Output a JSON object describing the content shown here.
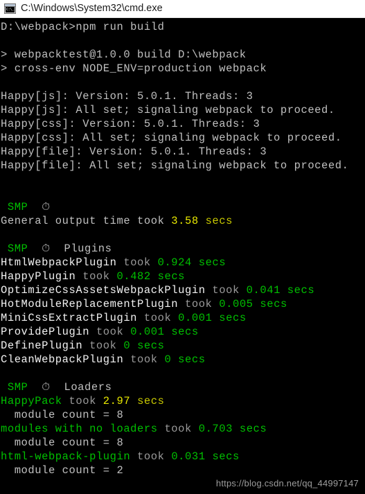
{
  "window": {
    "title": "C:\\Windows\\System32\\cmd.exe",
    "icon_name": "cmd-exe-icon",
    "icon_glyph": "C:\\_"
  },
  "colors": {
    "background": "#000000",
    "titlebar_background": "#ffffff",
    "default_text": "#c0c0c0",
    "bright_text": "#f2f2f2",
    "dim_text": "#9a9a9a",
    "green": "#00c000",
    "yellow": "#e8e800",
    "olive": "#c8c800",
    "watermark": "#9d9d9d"
  },
  "console": {
    "prompt": {
      "path": "D:\\webpack>",
      "command": "npm run build"
    },
    "npm_header": [
      "> webpacktest@1.0.0 build D:\\webpack",
      "> cross-env NODE_ENV=production webpack"
    ],
    "happy_lines": [
      "Happy[js]: Version: 5.0.1. Threads: 3",
      "Happy[js]: All set; signaling webpack to proceed.",
      "Happy[css]: Version: 5.0.1. Threads: 3",
      "Happy[css]: All set; signaling webpack to proceed.",
      "Happy[file]: Version: 5.0.1. Threads: 3",
      "Happy[file]: All set; signaling webpack to proceed."
    ],
    "smp_label": "SMP",
    "timer_icon": "⏱",
    "general": {
      "text": "General output time took",
      "value": "3.58",
      "unit": "secs"
    },
    "plugins_heading": "Plugins",
    "plugins": [
      {
        "name": "HtmlWebpackPlugin",
        "took": "took",
        "value": "0.924",
        "unit": "secs"
      },
      {
        "name": "HappyPlugin",
        "took": "took",
        "value": "0.482",
        "unit": "secs"
      },
      {
        "name": "OptimizeCssAssetsWebpackPlugin",
        "took": "took",
        "value": "0.041",
        "unit": "secs"
      },
      {
        "name": "HotModuleReplacementPlugin",
        "took": "took",
        "value": "0.005",
        "unit": "secs"
      },
      {
        "name": "MiniCssExtractPlugin",
        "took": "took",
        "value": "0.001",
        "unit": "secs"
      },
      {
        "name": "ProvidePlugin",
        "took": "took",
        "value": "0.001",
        "unit": "secs"
      },
      {
        "name": "DefinePlugin",
        "took": "took",
        "value": "0",
        "unit": "secs"
      },
      {
        "name": "CleanWebpackPlugin",
        "took": "took",
        "value": "0",
        "unit": "secs"
      }
    ],
    "loaders_heading": "Loaders",
    "loaders": [
      {
        "name": "HappyPack",
        "took": "took",
        "value": "2.97",
        "unit": "secs",
        "detail": "  module count = 8",
        "highlight": "yellow"
      },
      {
        "name": "modules with no loaders",
        "took": "took",
        "value": "0.703",
        "unit": "secs",
        "detail": "  module count = 8",
        "highlight": "green"
      },
      {
        "name": "html-webpack-plugin",
        "took": "took",
        "value": "0.031",
        "unit": "secs",
        "detail": "  module count = 2",
        "highlight": "green"
      }
    ]
  },
  "watermark": "https://blog.csdn.net/qq_44997147"
}
